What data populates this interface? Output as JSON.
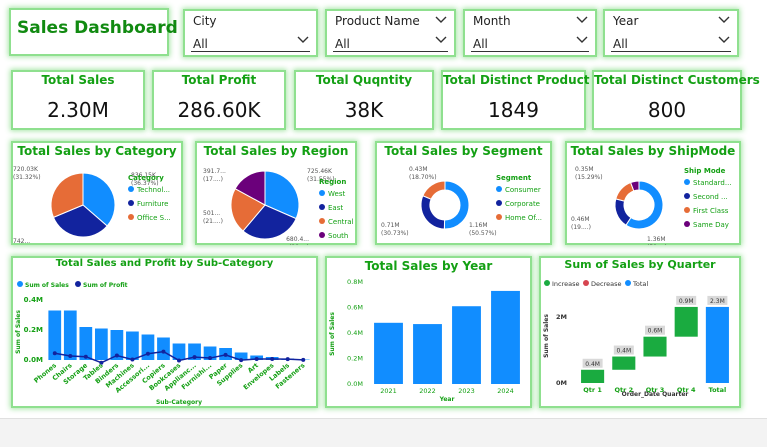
{
  "header": {
    "title": "Sales Dashboard"
  },
  "slicers": [
    {
      "label": "City",
      "value": "All"
    },
    {
      "label": "Product Name",
      "value": "All"
    },
    {
      "label": "Month",
      "value": "All"
    },
    {
      "label": "Year",
      "value": "All"
    }
  ],
  "kpis": [
    {
      "title": "Total Sales",
      "value": "2.30M"
    },
    {
      "title": "Total Profit",
      "value": "286.60K"
    },
    {
      "title": "Total Quqntity",
      "value": "38K"
    },
    {
      "title": "Total Distinct Product",
      "value": "1849"
    },
    {
      "title": "Total Distinct Customers",
      "value": "800"
    }
  ],
  "colors": {
    "blue": "#118dff",
    "navy": "#12239e",
    "orange": "#e66c37",
    "purple": "#6b007b",
    "green": "#1aab40",
    "red": "#d64550",
    "title_green": "#14a014"
  },
  "chart_data": [
    {
      "type": "pie",
      "title": "Total Sales by Category",
      "legend_title": "Category",
      "labels": [
        "Technol...",
        "Furniture",
        "Office S..."
      ],
      "values": [
        836.15,
        742.0,
        720.03
      ],
      "data_labels": [
        "836.15K (36.37%)",
        "742... (32...)",
        "720.03K (31.32%)"
      ],
      "legend_position": "right"
    },
    {
      "type": "pie",
      "title": "Total Sales by Region",
      "legend_title": "Region",
      "labels": [
        "West",
        "East",
        "Central",
        "South"
      ],
      "values": [
        725.46,
        680.4,
        501.0,
        391.7
      ],
      "data_labels": [
        "725.46K (31.55%)",
        "680.4... (29....)",
        "501... (21....)",
        "391.7... (17....)"
      ],
      "legend_position": "right"
    },
    {
      "type": "pie",
      "title": "Total Sales by Segment",
      "legend_title": "Segment",
      "labels": [
        "Consumer",
        "Corporate",
        "Home Of..."
      ],
      "values": [
        1.16,
        0.71,
        0.43
      ],
      "data_labels": [
        "1.16M (50.57%)",
        "0.71M (30.73%)",
        "0.43M (18.70%)"
      ],
      "legend_position": "right"
    },
    {
      "type": "pie",
      "title": "Total Sales by ShipMode",
      "legend_title": "Ship Mode",
      "labels": [
        "Standard...",
        "Second ...",
        "First Class",
        "Same Day"
      ],
      "values": [
        1.36,
        0.46,
        0.35,
        0.13
      ],
      "data_labels": [
        "1.36M (59....)",
        "0.46M (19....)",
        "0.35M (15.29%)",
        ""
      ],
      "legend_position": "right"
    },
    {
      "type": "bar",
      "title": "Total Sales and Profit by Sub-Category",
      "xlabel": "Sub-Category",
      "ylabel": "Sum of Sales",
      "legend_position": "top-left",
      "categories": [
        "Phones",
        "Chairs",
        "Storage",
        "Tables",
        "Binders",
        "Machines",
        "Accessori...",
        "Copiers",
        "Bookcases",
        "Applianc...",
        "Furnishi...",
        "Paper",
        "Supplies",
        "Art",
        "Envelopes",
        "Labels",
        "Fasteners"
      ],
      "yticks": [
        "0.0M",
        "0.2M",
        "0.4M"
      ],
      "ylim": [
        0,
        0.4
      ],
      "series": [
        {
          "name": "Sum of Sales",
          "values": [
            0.33,
            0.33,
            0.22,
            0.21,
            0.2,
            0.19,
            0.17,
            0.15,
            0.11,
            0.11,
            0.09,
            0.08,
            0.05,
            0.03,
            0.02,
            0.01,
            0.003
          ]
        },
        {
          "name": "Sum of Profit",
          "values": [
            0.045,
            0.027,
            0.022,
            -0.018,
            0.03,
            0.003,
            0.042,
            0.056,
            -0.003,
            0.019,
            0.013,
            0.034,
            -0.001,
            0.007,
            0.007,
            0.006,
            0.001
          ]
        }
      ]
    },
    {
      "type": "bar",
      "title": "Total Sales by Year",
      "xlabel": "Year",
      "ylabel": "Sum of Sales",
      "categories": [
        "2021",
        "2022",
        "2023",
        "2024"
      ],
      "values": [
        0.48,
        0.47,
        0.61,
        0.73
      ],
      "yticks": [
        "0.0M",
        "0.2M",
        "0.4M",
        "0.6M",
        "0.8M"
      ],
      "ylim": [
        0,
        0.8
      ]
    },
    {
      "type": "bar",
      "title": "Sum of Sales by Quarter",
      "subtype": "waterfall",
      "xlabel": "Order_Date Quarter",
      "ylabel": "Sum of Sales",
      "legend": [
        "Increase",
        "Decrease",
        "Total"
      ],
      "legend_position": "top-left",
      "categories": [
        "Qtr 1",
        "Qtr 2",
        "Qtr 3",
        "Qtr 4",
        "Total"
      ],
      "values": [
        0.4,
        0.4,
        0.6,
        0.9,
        2.3
      ],
      "data_labels": [
        "0.4M",
        "0.4M",
        "0.6M",
        "0.9M",
        "2.3M"
      ],
      "yticks": [
        "0M",
        "2M"
      ],
      "ylim": [
        0,
        2.6
      ]
    }
  ]
}
